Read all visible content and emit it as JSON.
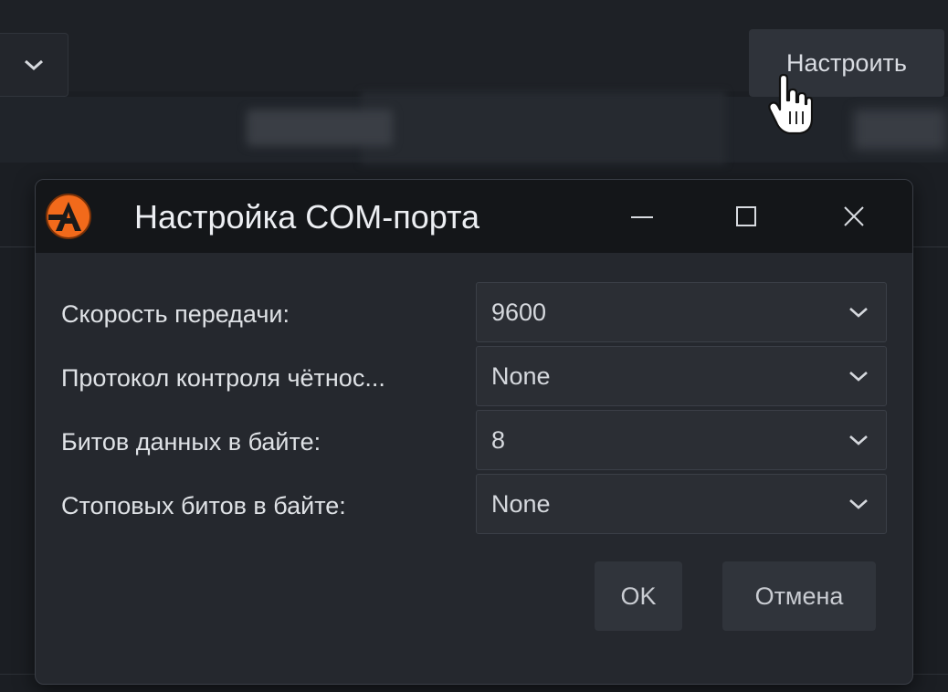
{
  "toolbar": {
    "configure_label": "Настроить"
  },
  "dialog": {
    "title": "Настройка COM-порта",
    "fields": [
      {
        "label": "Скорость передачи:",
        "value": "9600"
      },
      {
        "label": "Протокол контроля чётнос...",
        "value": "None"
      },
      {
        "label": "Битов данных в байте:",
        "value": "8"
      },
      {
        "label": "Стоповых битов в байте:",
        "value": "None"
      }
    ],
    "ok_label": "OK",
    "cancel_label": "Отмена"
  },
  "colors": {
    "background": "#1b1e23",
    "dialog": "#25282e",
    "titlebar": "#141619",
    "logo_accent": "#f26a1b"
  },
  "icons": [
    "chevron-down-icon",
    "app-logo-icon",
    "minimize-icon",
    "maximize-icon",
    "close-icon",
    "hand-cursor-icon"
  ]
}
